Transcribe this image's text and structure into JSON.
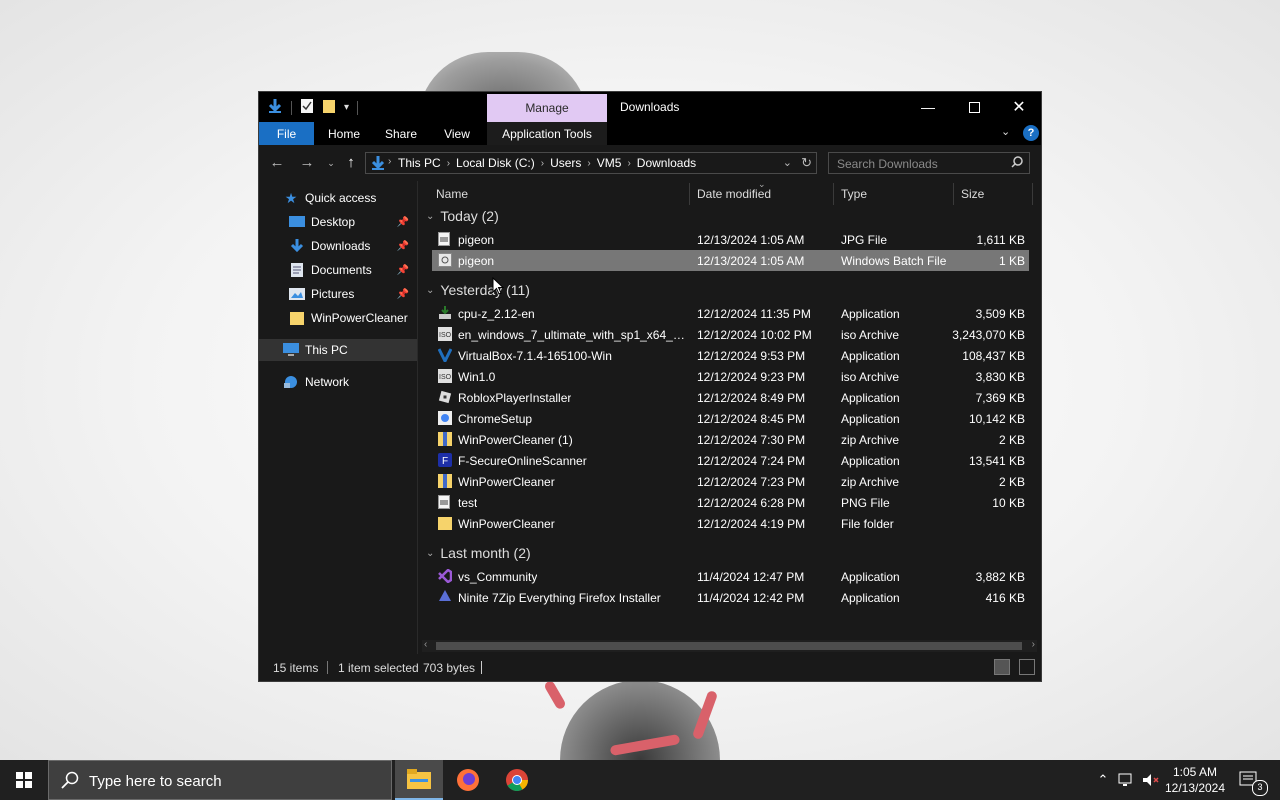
{
  "window": {
    "title": "Downloads",
    "contextual_tab": "Manage",
    "ribbon_tabs": [
      "File",
      "Home",
      "Share",
      "View",
      "Application Tools"
    ]
  },
  "address": {
    "crumbs": [
      "This PC",
      "Local Disk (C:)",
      "Users",
      "VM5",
      "Downloads"
    ],
    "search_placeholder": "Search Downloads"
  },
  "nav": {
    "quick_access": "Quick access",
    "pinned": [
      "Desktop",
      "Downloads",
      "Documents",
      "Pictures"
    ],
    "extra": "WinPowerCleaner",
    "this_pc": "This PC",
    "network": "Network"
  },
  "columns": [
    "Name",
    "Date modified",
    "Type",
    "Size"
  ],
  "groups": [
    {
      "label": "Today (2)",
      "files": [
        {
          "name": "pigeon",
          "date": "12/13/2024 1:05 AM",
          "type": "JPG File",
          "size": "1,611 KB",
          "icon": "image-file-icon"
        },
        {
          "name": "pigeon",
          "date": "12/13/2024 1:05 AM",
          "type": "Windows Batch File",
          "size": "1 KB",
          "icon": "batch-file-icon",
          "selected": true
        }
      ]
    },
    {
      "label": "Yesterday (11)",
      "files": [
        {
          "name": "cpu-z_2.12-en",
          "date": "12/12/2024 11:35 PM",
          "type": "Application",
          "size": "3,509 KB",
          "icon": "installer-icon"
        },
        {
          "name": "en_windows_7_ultimate_with_sp1_x64_dv...",
          "date": "12/12/2024 10:02 PM",
          "type": "iso Archive",
          "size": "3,243,070 KB",
          "icon": "iso-archive-icon"
        },
        {
          "name": "VirtualBox-7.1.4-165100-Win",
          "date": "12/12/2024 9:53 PM",
          "type": "Application",
          "size": "108,437 KB",
          "icon": "virtualbox-icon"
        },
        {
          "name": "Win1.0",
          "date": "12/12/2024 9:23 PM",
          "type": "iso Archive",
          "size": "3,830 KB",
          "icon": "iso-archive-icon"
        },
        {
          "name": "RobloxPlayerInstaller",
          "date": "12/12/2024 8:49 PM",
          "type": "Application",
          "size": "7,369 KB",
          "icon": "roblox-icon"
        },
        {
          "name": "ChromeSetup",
          "date": "12/12/2024 8:45 PM",
          "type": "Application",
          "size": "10,142 KB",
          "icon": "chrome-setup-icon"
        },
        {
          "name": "WinPowerCleaner (1)",
          "date": "12/12/2024 7:30 PM",
          "type": "zip Archive",
          "size": "2 KB",
          "icon": "zip-archive-icon"
        },
        {
          "name": "F-SecureOnlineScanner",
          "date": "12/12/2024 7:24 PM",
          "type": "Application",
          "size": "13,541 KB",
          "icon": "fsecure-icon"
        },
        {
          "name": "WinPowerCleaner",
          "date": "12/12/2024 7:23 PM",
          "type": "zip Archive",
          "size": "2 KB",
          "icon": "zip-archive-icon"
        },
        {
          "name": "test",
          "date": "12/12/2024 6:28 PM",
          "type": "PNG File",
          "size": "10 KB",
          "icon": "image-file-icon"
        },
        {
          "name": "WinPowerCleaner",
          "date": "12/12/2024 4:19 PM",
          "type": "File folder",
          "size": "",
          "icon": "folder-icon"
        }
      ]
    },
    {
      "label": "Last month (2)",
      "files": [
        {
          "name": "vs_Community",
          "date": "11/4/2024 12:47 PM",
          "type": "Application",
          "size": "3,882 KB",
          "icon": "visual-studio-icon"
        },
        {
          "name": "Ninite 7Zip Everything Firefox Installer",
          "date": "11/4/2024 12:42 PM",
          "type": "Application",
          "size": "416 KB",
          "icon": "ninite-icon"
        }
      ]
    }
  ],
  "status": {
    "items": "15 items",
    "selected": "1 item selected",
    "size": "703 bytes"
  },
  "taskbar": {
    "search_placeholder": "Type here to search",
    "time": "1:05 AM",
    "date": "12/13/2024",
    "notifications": "3"
  },
  "colors": {
    "accent": "#1a6fc4",
    "manage_tab": "#e1c9f3",
    "selection": "#777777"
  }
}
